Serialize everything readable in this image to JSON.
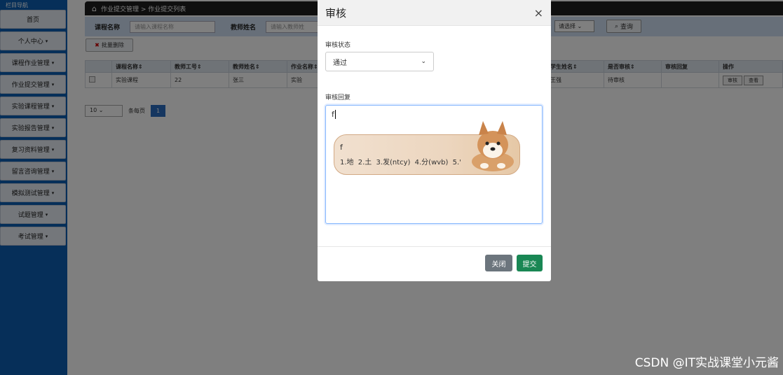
{
  "sidebar": {
    "title": "栏目导航",
    "items": [
      {
        "label": "首页",
        "caret": ""
      },
      {
        "label": "个人中心",
        "caret": "▾"
      },
      {
        "label": "课程作业管理",
        "caret": "▾"
      },
      {
        "label": "作业提交管理",
        "caret": "▾"
      },
      {
        "label": "实验课程管理",
        "caret": "▾"
      },
      {
        "label": "实验报告管理",
        "caret": "▾"
      },
      {
        "label": "复习资料管理",
        "caret": "▾"
      },
      {
        "label": "留言咨询管理",
        "caret": "▾"
      },
      {
        "label": "模拟测试管理",
        "caret": "▾"
      },
      {
        "label": "试题管理",
        "caret": "▾"
      },
      {
        "label": "考试管理",
        "caret": "▾"
      }
    ]
  },
  "breadcrumb": "作业提交管理 > 作业提交列表",
  "search": {
    "course_label": "课程名称",
    "course_placeholder": "请输入课程名称",
    "teacher_label": "教师姓名",
    "teacher_placeholder": "请输入教师姓",
    "select_value": "请选择",
    "query_label": "查询"
  },
  "bulk_delete_label": "批量删除",
  "table": {
    "headers": [
      "",
      "课程名称⇕",
      "教师工号⇕",
      "教师姓名⇕",
      "作业名称⇕",
      "学生姓名⇕",
      "是否审核⇕",
      "审核回复",
      "操作"
    ],
    "rows": [
      {
        "course": "实验课程",
        "teacher_no": "22",
        "teacher_name": "张三",
        "hw_name": "实验",
        "student": "王强",
        "audited": "待审核",
        "reply": ""
      }
    ],
    "ops": [
      "审核",
      "查看"
    ]
  },
  "pager": {
    "size": "10",
    "per_page": "条每页",
    "current": "1"
  },
  "modal": {
    "title": "审核",
    "close_icon": "×",
    "status_label": "审核状态",
    "status_value": "通过",
    "reply_label": "审核回复",
    "reply_value": "f",
    "ime": {
      "composition": "f",
      "candidates": "1.地  2.土  3.发(ntcy)  4.分(wvb)  5.'"
    },
    "close_button": "关闭",
    "submit_button": "提交"
  },
  "watermark": "CSDN @IT实战课堂小元酱"
}
